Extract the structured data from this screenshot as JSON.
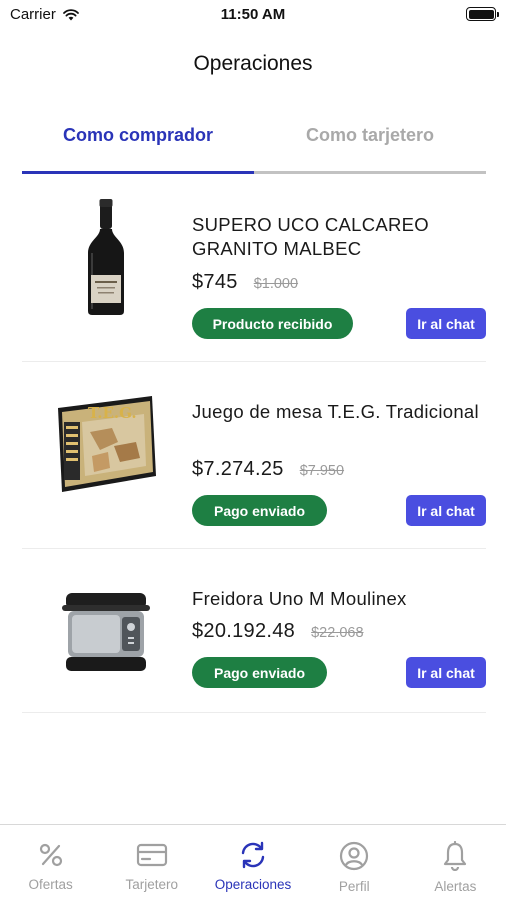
{
  "status_bar": {
    "carrier": "Carrier",
    "time": "11:50 AM"
  },
  "header": {
    "title": "Operaciones"
  },
  "tabs": [
    {
      "label": "Como comprador",
      "active": true
    },
    {
      "label": "Como tarjetero",
      "active": false
    }
  ],
  "operations": [
    {
      "title": "SUPERO UCO CALCAREO GRANITO MALBEC",
      "price": "$745",
      "old_price": "$1.000",
      "status": "Producto recibido",
      "chat_label": "Ir al chat",
      "image": "wine-bottle"
    },
    {
      "title": "Juego de mesa T.E.G. Tradicional",
      "price": "$7.274.25",
      "old_price": "$7.950",
      "status": "Pago enviado",
      "chat_label": "Ir al chat",
      "image": "board-game-box",
      "box_text": "T.E.G."
    },
    {
      "title": "Freidora Uno M Moulinex",
      "price": "$20.192.48",
      "old_price": "$22.068",
      "status": "Pago enviado",
      "chat_label": "Ir al chat",
      "image": "deep-fryer"
    }
  ],
  "tab_bar": [
    {
      "label": "Ofertas",
      "icon": "percent-icon",
      "active": false
    },
    {
      "label": "Tarjetero",
      "icon": "card-icon",
      "active": false
    },
    {
      "label": "Operaciones",
      "icon": "sync-icon",
      "active": true
    },
    {
      "label": "Perfil",
      "icon": "profile-icon",
      "active": false
    },
    {
      "label": "Alertas",
      "icon": "bell-icon",
      "active": false
    }
  ],
  "colors": {
    "accent": "#2a34b8",
    "status_green": "#1e7f43",
    "chat_button": "#4a4ee0",
    "inactive": "#a0a0a0"
  }
}
